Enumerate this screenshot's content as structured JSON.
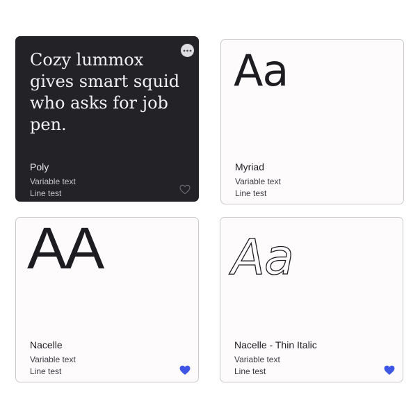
{
  "colors": {
    "dark_card_bg": "#232227",
    "light_card_bg": "#fdfbfc",
    "favorite_active": "#3f56e4",
    "favorite_inactive_outline": "#6e6d73"
  },
  "cards": [
    {
      "sample": "Cozy lummox gives smart squid who asks for job pen.",
      "font_name": "Poly",
      "meta1": "Variable text",
      "meta2": "Line test",
      "has_more_button": true,
      "more_icon": "more-horizontal-icon",
      "favorite": false,
      "favorite_icon": "heart-outline-icon"
    },
    {
      "sample": "Aa",
      "font_name": "Myriad",
      "meta1": "Variable text",
      "meta2": "Line test",
      "favorite": false
    },
    {
      "sample": "AA",
      "font_name": "Nacelle",
      "meta1": "Variable text",
      "meta2": "Line test",
      "favorite": true,
      "favorite_icon": "heart-filled-icon"
    },
    {
      "sample": "Aa",
      "font_name": "Nacelle - Thin Italic",
      "meta1": "Variable text",
      "meta2": "Line test",
      "favorite": true,
      "favorite_icon": "heart-filled-icon"
    }
  ]
}
